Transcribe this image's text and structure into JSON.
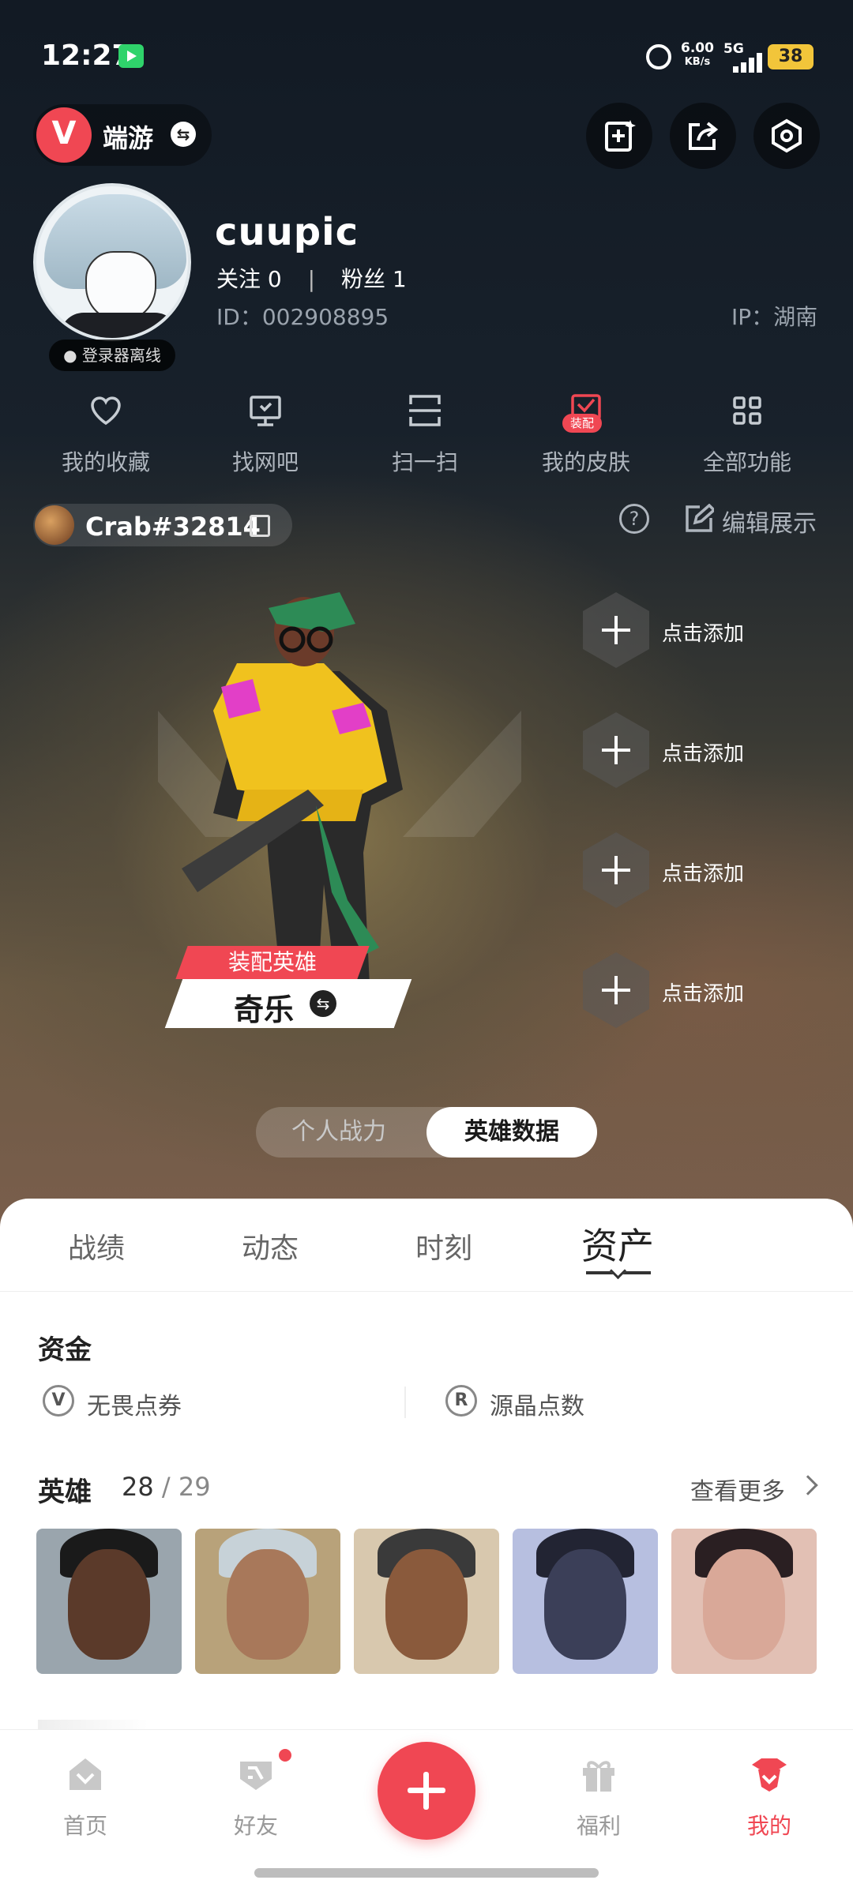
{
  "status_bar": {
    "time": "12:27",
    "net_speed_value": "6.00",
    "net_speed_unit": "KB/s",
    "network": "5G",
    "battery": "38"
  },
  "top_bar": {
    "brand_label": "端游",
    "icons": [
      "add-card-icon",
      "share-icon",
      "settings-icon"
    ]
  },
  "profile": {
    "username": "cuupic",
    "follow_text": "关注 0",
    "fans_text": "粉丝 1",
    "id_text": "ID：002908895",
    "ip_text": "IP：湖南",
    "login_state": "登录器离线"
  },
  "functions": [
    {
      "label": "我的收藏",
      "icon": "heart-icon"
    },
    {
      "label": "找网吧",
      "icon": "monitor-icon"
    },
    {
      "label": "扫一扫",
      "icon": "scan-icon"
    },
    {
      "label": "我的皮肤",
      "icon": "skin-icon",
      "badge": "装配"
    },
    {
      "label": "全部功能",
      "icon": "grid-icon"
    }
  ],
  "riot": {
    "name": "Crab#32814",
    "edit_label": "编辑展示"
  },
  "hero_display": {
    "equip_label": "装配英雄",
    "hero_name": "奇乐",
    "slots": [
      "点击添加",
      "点击添加",
      "点击添加",
      "点击添加"
    ]
  },
  "toggle": {
    "option1": "个人战力",
    "option2": "英雄数据",
    "selected": "英雄数据"
  },
  "tabs": {
    "items": [
      "战绩",
      "动态",
      "时刻",
      "资产"
    ],
    "active": "资产"
  },
  "assets": {
    "funds_title": "资金",
    "fund1": "无畏点券",
    "fund2": "源晶点数",
    "heroes_title": "英雄",
    "heroes_owned": "28",
    "heroes_total": "/ 29",
    "more_label": "查看更多"
  },
  "nav": {
    "items": [
      "首页",
      "好友",
      "福利",
      "我的"
    ],
    "active": "我的"
  },
  "colors": {
    "accent": "#f04753",
    "sheet": "#ffffff",
    "bg_dark": "#141a22"
  }
}
